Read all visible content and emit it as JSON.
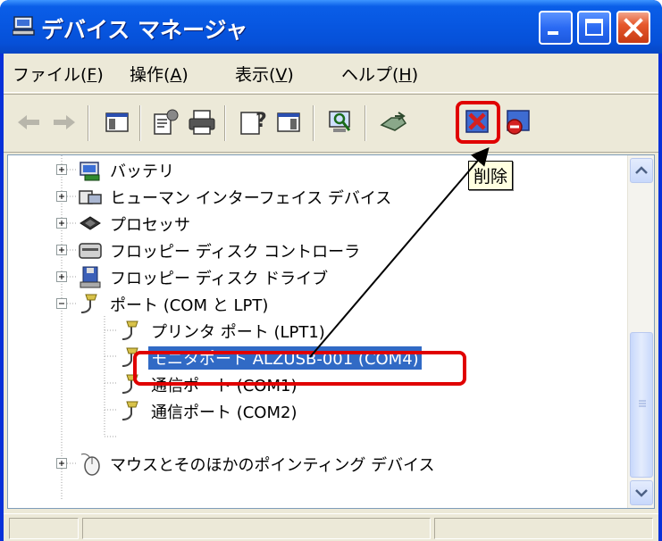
{
  "window": {
    "title": "デバイス マネージャ",
    "icon": "computer-manager-icon"
  },
  "menu": {
    "file": "ファイル(",
    "file_key": "F",
    "action": "操作(",
    "action_key": "A",
    "view": "表示(",
    "view_key": "V",
    "help": "ヘルプ(",
    "help_key": "H",
    "close_paren": ")"
  },
  "toolbar": {
    "buttons": [
      "back-arrow-icon",
      "forward-arrow-icon",
      "show-hide-tree-icon",
      "properties-icon",
      "print-icon",
      "help-icon",
      "show-hide-action-pane-icon",
      "scan-hardware-icon",
      "update-driver-icon",
      "uninstall-icon",
      "disable-icon"
    ],
    "highlight_color": "#e00000"
  },
  "tooltip": {
    "text": "削除"
  },
  "tree": {
    "items": [
      {
        "label": "バッテリ",
        "icon": "battery-icon",
        "expanded": false
      },
      {
        "label": "ヒューマン インターフェイス デバイス",
        "icon": "hid-icon",
        "expanded": false
      },
      {
        "label": "プロセッサ",
        "icon": "processor-icon",
        "expanded": false
      },
      {
        "label": "フロッピー ディスク コントローラ",
        "icon": "floppy-controller-icon",
        "expanded": false
      },
      {
        "label": "フロッピー ディスク ドライブ",
        "icon": "floppy-drive-icon",
        "expanded": false
      },
      {
        "label": "ポート (COM と LPT)",
        "icon": "port-icon",
        "expanded": true
      },
      {
        "label": "プリンタ ポート (LPT1)",
        "icon": "port-icon",
        "child": true
      },
      {
        "label": "モニタポート ALZUSB-001 (COM4)",
        "icon": "port-icon",
        "child": true,
        "selected": true
      },
      {
        "label": "通信ポート (COM1)",
        "icon": "port-icon",
        "child": true
      },
      {
        "label": "通信ポート (COM2)",
        "icon": "port-icon",
        "child": true
      },
      {
        "label": "マウスとそのほかのポインティング デバイス",
        "icon": "mouse-icon",
        "expanded": false
      }
    ]
  },
  "colors": {
    "titlebar": "#0756e0",
    "selection": "#316ac5",
    "annotation_red": "#e00000"
  }
}
